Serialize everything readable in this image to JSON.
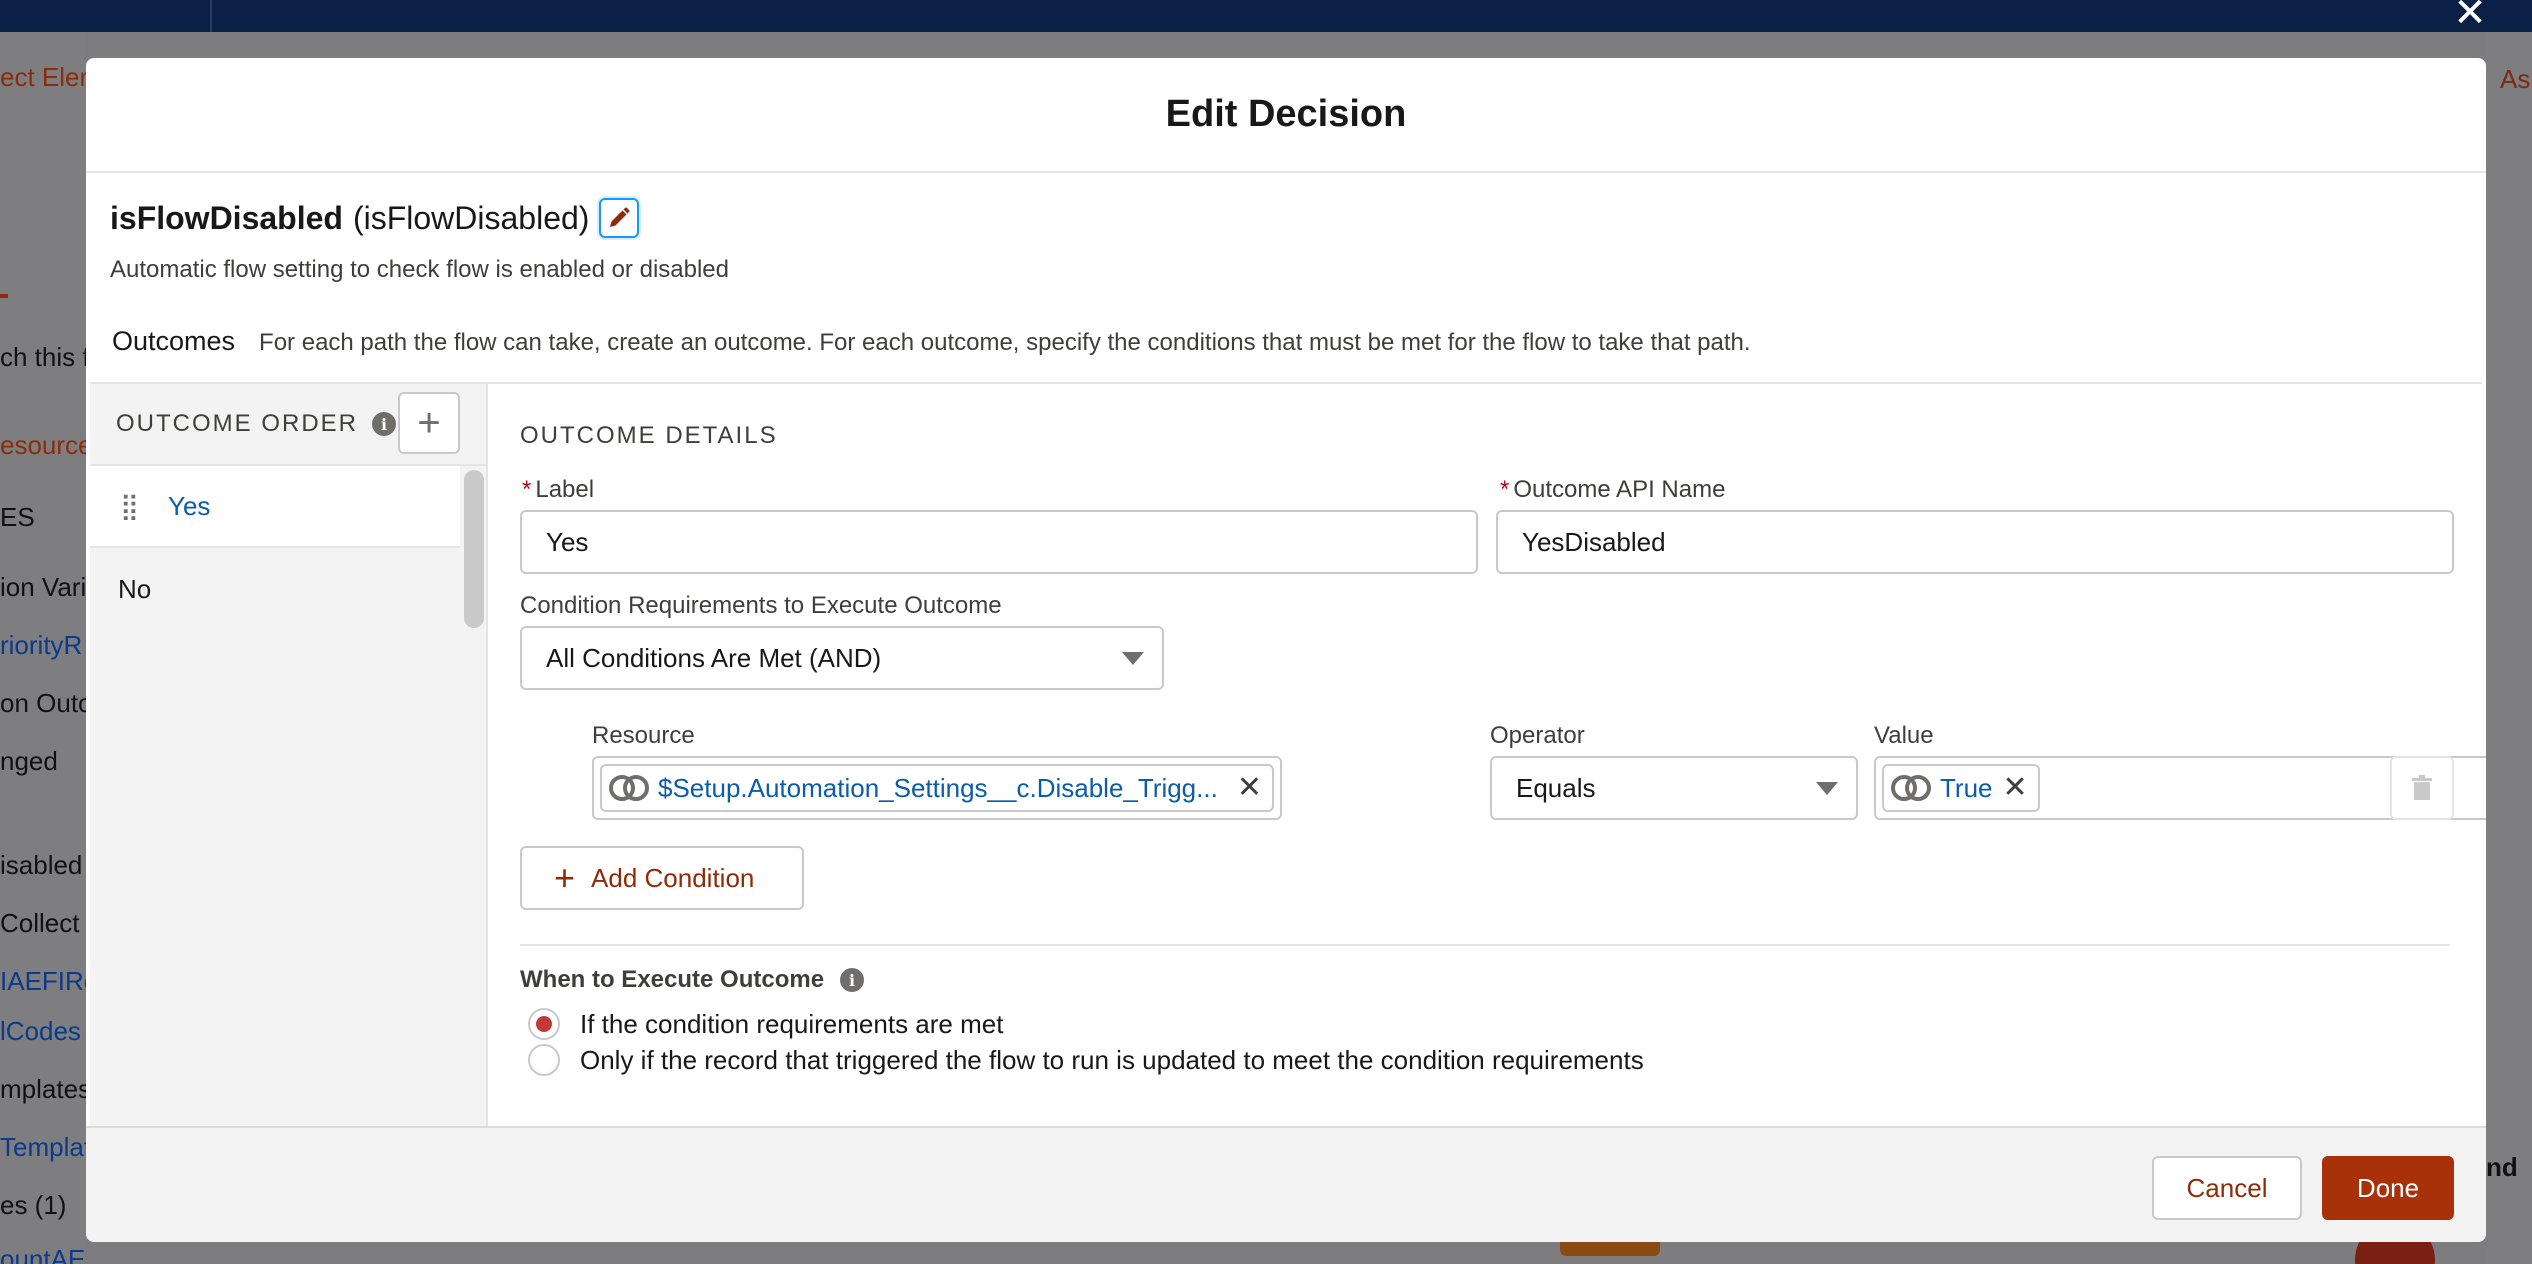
{
  "background": {
    "sidebar_items": [
      {
        "text": "ect Elem",
        "style": "orange"
      },
      {
        "text": "ch this f",
        "style": "plain"
      },
      {
        "text": "esource",
        "style": "orange"
      },
      {
        "text": "ES",
        "style": "plain"
      },
      {
        "text": "ion Vari",
        "style": "plain"
      },
      {
        "text": "riorityR",
        "style": "link"
      },
      {
        "text": "on Outc",
        "style": "plain"
      },
      {
        "text": "nged",
        "style": "plain"
      },
      {
        "text": "isabled",
        "style": "plain"
      },
      {
        "text": " Collect",
        "style": "plain"
      },
      {
        "text": "IAEFIRe",
        "style": "link"
      },
      {
        "text": "lCodes",
        "style": "link"
      },
      {
        "text": "mplates",
        "style": "plain"
      },
      {
        "text": "Templat",
        "style": "link"
      },
      {
        "text": "es (1)",
        "style": "plain"
      },
      {
        "text": "ountAEFIReports",
        "style": "link"
      }
    ],
    "right_text": "As",
    "right_bold": "nd"
  },
  "modal": {
    "title": "Edit Decision",
    "flow_name": "isFlowDisabled",
    "flow_api_name": "(isFlowDisabled)",
    "description": "Automatic flow setting to check flow is enabled or disabled",
    "outcomes_label": "Outcomes",
    "outcomes_help": "For each path the flow can take, create an outcome. For each outcome, specify the conditions that must be met for the flow to take that path.",
    "outcome_order_title": "OUTCOME ORDER",
    "outcomes": [
      {
        "label": "Yes",
        "active": true
      },
      {
        "label": "No",
        "active": false
      }
    ],
    "details": {
      "title": "OUTCOME DETAILS",
      "label_field": {
        "label": "Label",
        "value": "Yes"
      },
      "api_field": {
        "label": "Outcome API Name",
        "value": "YesDisabled"
      },
      "condition_req": {
        "label": "Condition Requirements to Execute Outcome",
        "value": "All Conditions Are Met (AND)"
      },
      "condition": {
        "resource_label": "Resource",
        "resource_value": "$Setup.Automation_Settings__c.Disable_Trigg...",
        "operator_label": "Operator",
        "operator_value": "Equals",
        "value_label": "Value",
        "value_value": "True"
      },
      "add_condition": "Add Condition",
      "when_title": "When to Execute Outcome",
      "radio_options": [
        {
          "label": "If the condition requirements are met",
          "checked": true
        },
        {
          "label": "Only if the record that triggered the flow to run is updated to meet the condition requirements",
          "checked": false
        }
      ]
    },
    "footer": {
      "cancel": "Cancel",
      "done": "Done"
    }
  },
  "colors": {
    "brand_button": "#a8310a",
    "link": "#0b5cab",
    "required": "#ba0517",
    "top_bar": "#0b2045"
  }
}
